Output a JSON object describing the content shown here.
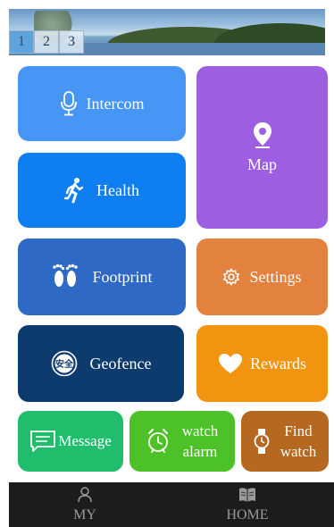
{
  "banner": {
    "pages": [
      "1",
      "2",
      "3"
    ],
    "active_page": "1"
  },
  "tiles": {
    "intercom": {
      "label": "Intercom",
      "icon": "microphone-icon",
      "color": "#4795f5"
    },
    "map": {
      "label": "Map",
      "icon": "location-pin-icon",
      "color": "#9d5ee2"
    },
    "health": {
      "label": "Health",
      "icon": "running-person-icon",
      "color": "#0f7ef0"
    },
    "footprint": {
      "label": "Footprint",
      "icon": "footprints-icon",
      "color": "#2e69c6"
    },
    "settings": {
      "label": "Settings",
      "icon": "gear-icon",
      "color": "#e3813f"
    },
    "geofence": {
      "label": "Geofence",
      "icon": "safety-badge-icon",
      "color": "#0e3b6e",
      "icon_text": "安全"
    },
    "rewards": {
      "label": "Rewards",
      "icon": "heart-icon",
      "color": "#f39411"
    },
    "message": {
      "label": "Message",
      "icon": "message-icon",
      "color": "#1fbd6c"
    },
    "watch_alarm": {
      "label": "watch\nalarm",
      "icon": "alarm-clock-icon",
      "color": "#4dc128"
    },
    "find_watch": {
      "label": "Find\nwatch",
      "icon": "watch-icon",
      "color": "#b5681f"
    }
  },
  "tabbar": {
    "my": {
      "label": "MY",
      "icon": "person-icon"
    },
    "home": {
      "label": "HOME",
      "icon": "book-icon"
    }
  }
}
